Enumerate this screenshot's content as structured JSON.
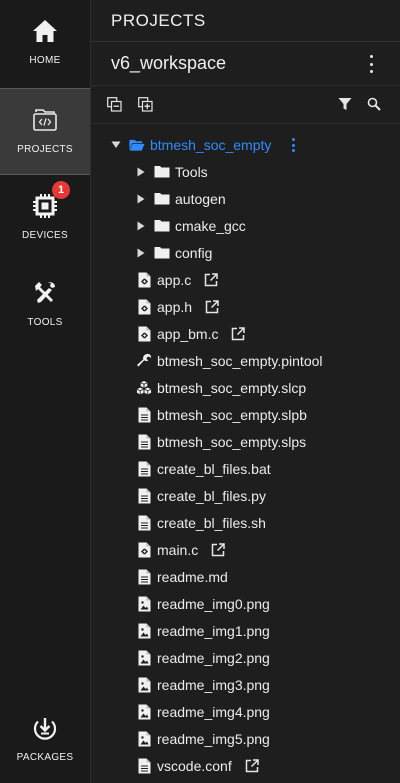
{
  "activity_bar": {
    "items": [
      {
        "label": "HOME",
        "icon": "home-icon"
      },
      {
        "label": "PROJECTS",
        "icon": "projects-icon",
        "active": true
      },
      {
        "label": "DEVICES",
        "icon": "chip-icon",
        "badge": "1"
      },
      {
        "label": "TOOLS",
        "icon": "tools-icon"
      },
      {
        "label": "PACKAGES",
        "icon": "download-circle-icon"
      }
    ],
    "badge_color": "#e53935"
  },
  "panel": {
    "title": "PROJECTS",
    "workspace": "v6_workspace"
  },
  "toolbar": {
    "buttons": [
      "collapse-all-icon",
      "copy-icon",
      "filter-icon",
      "search-icon"
    ]
  },
  "tree": {
    "root": "btmesh_soc_empty",
    "folders": [
      "Tools",
      "autogen",
      "cmake_gcc",
      "config"
    ],
    "files": [
      {
        "name": "app.c",
        "icon": "c-file-icon",
        "external": true
      },
      {
        "name": "app.h",
        "icon": "c-file-icon",
        "external": true
      },
      {
        "name": "app_bm.c",
        "icon": "c-file-icon",
        "external": true
      },
      {
        "name": "btmesh_soc_empty.pintool",
        "icon": "wrench-icon"
      },
      {
        "name": "btmesh_soc_empty.slcp",
        "icon": "cubes-icon"
      },
      {
        "name": "btmesh_soc_empty.slpb",
        "icon": "file-text-icon"
      },
      {
        "name": "btmesh_soc_empty.slps",
        "icon": "file-text-icon"
      },
      {
        "name": "create_bl_files.bat",
        "icon": "file-text-icon"
      },
      {
        "name": "create_bl_files.py",
        "icon": "file-text-icon"
      },
      {
        "name": "create_bl_files.sh",
        "icon": "file-text-icon"
      },
      {
        "name": "main.c",
        "icon": "c-file-icon",
        "external": true
      },
      {
        "name": "readme.md",
        "icon": "file-text-icon"
      },
      {
        "name": "readme_img0.png",
        "icon": "image-file-icon"
      },
      {
        "name": "readme_img1.png",
        "icon": "image-file-icon"
      },
      {
        "name": "readme_img2.png",
        "icon": "image-file-icon"
      },
      {
        "name": "readme_img3.png",
        "icon": "image-file-icon"
      },
      {
        "name": "readme_img4.png",
        "icon": "image-file-icon"
      },
      {
        "name": "readme_img5.png",
        "icon": "image-file-icon"
      },
      {
        "name": "vscode.conf",
        "icon": "file-text-icon",
        "external": true
      }
    ],
    "accent_color": "#2f8cff"
  }
}
